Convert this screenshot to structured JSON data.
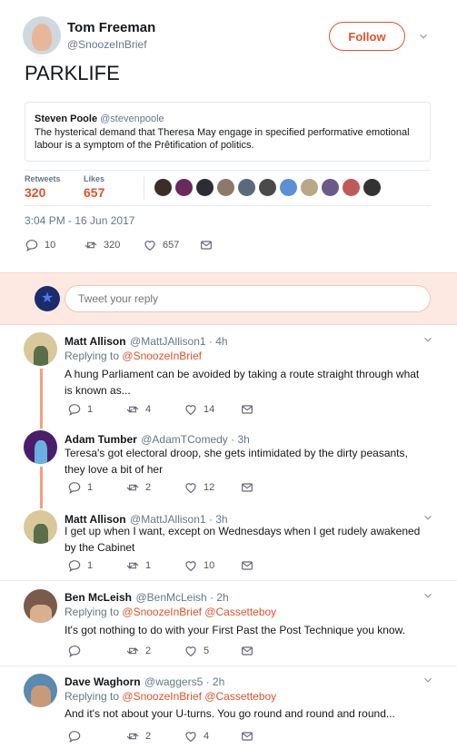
{
  "tweet": {
    "author_name": "Tom Freeman",
    "author_handle": "@SnoozeInBrief",
    "follow_label": "Follow",
    "text": "PARKLIFE",
    "quote": {
      "author_name": "Steven Poole",
      "author_handle": "@stevenpoole",
      "text": "The hysterical demand that Theresa May engage in specified performative emotional labour is a symptom of the Prêtification of politics."
    },
    "stats": {
      "retweets_label": "Retweets",
      "retweets_value": "320",
      "likes_label": "Likes",
      "likes_value": "657"
    },
    "timestamp": "3:04 PM - 16 Jun 2017",
    "actions": {
      "replies": "10",
      "retweets": "320",
      "likes": "657"
    }
  },
  "composer": {
    "placeholder": "Tweet your reply"
  },
  "replies": [
    {
      "name": "Matt Allison",
      "handle": "@MattJAllison1 · 4h",
      "replying_prefix": "Replying to",
      "replying_to": "@SnoozeInBrief",
      "replying_to_2": "",
      "text": "A hung Parliament can be avoided by taking a route straight through what is known as...",
      "replies": "1",
      "retweets": "4",
      "likes": "14"
    },
    {
      "name": "Adam Tumber",
      "handle": "@AdamTComedy · 3h",
      "text": "Teresa's got electoral droop, she gets intimidated by the dirty peasants, they love a bit of her",
      "replies": "1",
      "retweets": "2",
      "likes": "12"
    },
    {
      "name": "Matt Allison",
      "handle": "@MattJAllison1 · 3h",
      "text": "I get up when I want, except on Wednesdays when I get rudely awakened by the Cabinet",
      "replies": "1",
      "retweets": "1",
      "likes": "10"
    },
    {
      "name": "Ben McLeish",
      "handle": "@BenMcLeish · 2h",
      "replying_prefix": "Replying to",
      "replying_to": "@SnoozeInBrief",
      "replying_to_2": "@Cassetteboy",
      "text": "It's got nothing to do with your First Past the Post Technique you know.",
      "replies": "",
      "retweets": "2",
      "likes": "5"
    },
    {
      "name": "Dave Waghorn",
      "handle": "@waggers5 · 2h",
      "replying_prefix": "Replying to",
      "replying_to": "@SnoozeInBrief",
      "replying_to_2": "@Cassetteboy",
      "text": "And it's not about your U-turns. You go round and round and round...",
      "replies": "",
      "retweets": "2",
      "likes": "4"
    }
  ],
  "colors": {
    "accent": "#e0522a",
    "thread_line": "#f4a07a",
    "composer_bg": "#fde9e2"
  }
}
